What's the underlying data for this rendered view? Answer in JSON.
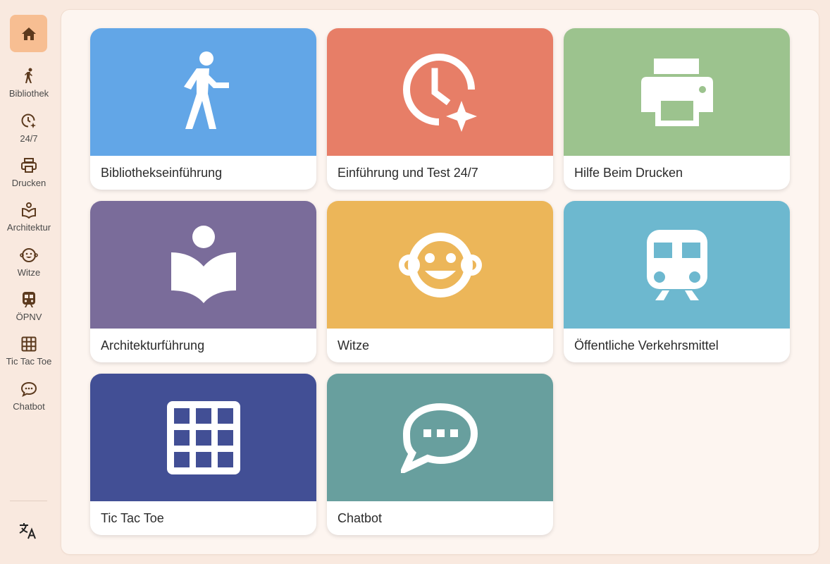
{
  "sidebar": {
    "home_icon": "home-icon",
    "items": [
      {
        "label": "Bibliothek",
        "icon": "walking-person-icon"
      },
      {
        "label": "24/7",
        "icon": "clock-sparkle-icon"
      },
      {
        "label": "Drucken",
        "icon": "printer-icon"
      },
      {
        "label": "Architektur",
        "icon": "reading-person-icon"
      },
      {
        "label": "Witze",
        "icon": "smiley-face-icon"
      },
      {
        "label": "ÖPNV",
        "icon": "train-icon"
      },
      {
        "label": "Tic Tac Toe",
        "icon": "grid-icon"
      },
      {
        "label": "Chatbot",
        "icon": "chat-bubble-icon"
      }
    ],
    "translate_icon": "translate-icon"
  },
  "cards": [
    {
      "title": "Bibliothekseinführung",
      "color": "#62a6e7",
      "icon": "walking-person-icon"
    },
    {
      "title": "Einführung und Test 24/7",
      "color": "#e77e67",
      "icon": "clock-sparkle-icon"
    },
    {
      "title": "Hilfe Beim Drucken",
      "color": "#9cc38e",
      "icon": "printer-icon"
    },
    {
      "title": "Architekturführung",
      "color": "#7a6c9a",
      "icon": "reading-person-icon"
    },
    {
      "title": "Witze",
      "color": "#ecb659",
      "icon": "smiley-face-icon"
    },
    {
      "title": "Öffentliche Verkehrsmittel",
      "color": "#6db8cf",
      "icon": "train-icon"
    },
    {
      "title": "Tic Tac Toe",
      "color": "#424f95",
      "icon": "grid-icon"
    },
    {
      "title": "Chatbot",
      "color": "#689f9e",
      "icon": "chat-bubble-icon"
    }
  ],
  "colors": {
    "sidebar_active": "#f7be92",
    "icon_dark": "#5c3a1e",
    "background": "#f9e9df",
    "panel": "#fdf5f0"
  }
}
